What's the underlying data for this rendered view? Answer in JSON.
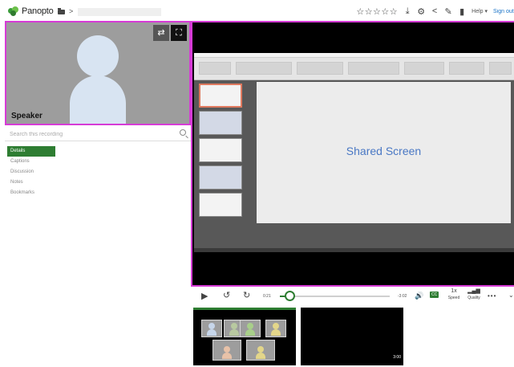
{
  "header": {
    "brand": "Panopto",
    "breadcrumb_separator": ">",
    "rating_stars": "☆☆☆☆☆",
    "help_label": "Help ▾",
    "signout_label": "Sign out",
    "icons": [
      "download-icon",
      "settings-gear-icon",
      "share-icon",
      "edit-pencil-icon",
      "stats-icon"
    ]
  },
  "speaker": {
    "label": "Speaker"
  },
  "search": {
    "placeholder": "Search this recording"
  },
  "sidebar": {
    "tabs": [
      {
        "label": "Details",
        "active": true
      },
      {
        "label": "Captions",
        "active": false
      },
      {
        "label": "Discussion",
        "active": false
      },
      {
        "label": "Notes",
        "active": false
      },
      {
        "label": "Bookmarks",
        "active": false
      }
    ]
  },
  "stage": {
    "slide_text": "Shared Screen"
  },
  "player": {
    "current_time": "0:21",
    "end_time": "-3:02",
    "progress_fraction": 0.09,
    "cc_label": "CC",
    "speed_value": "1x",
    "speed_label": "Speed",
    "quality_label": "Quality"
  },
  "streams": {
    "secondary_time": "3:00"
  },
  "colors": {
    "accent_green": "#2e7d32",
    "highlight_magenta": "#d63bd6",
    "slide_text_blue": "#4a78c4",
    "link_blue": "#1a73c8"
  }
}
